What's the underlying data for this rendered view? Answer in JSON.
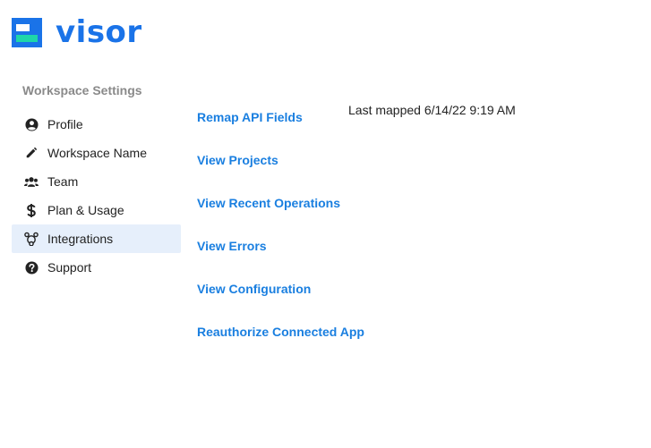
{
  "brand": {
    "name": "visor"
  },
  "sidebar": {
    "heading": "Workspace Settings",
    "items": [
      {
        "label": "Profile",
        "icon": "user-circle-icon"
      },
      {
        "label": "Workspace Name",
        "icon": "pencil-icon"
      },
      {
        "label": "Team",
        "icon": "users-icon"
      },
      {
        "label": "Plan & Usage",
        "icon": "dollar-icon"
      },
      {
        "label": "Integrations",
        "icon": "integrations-icon",
        "active": true
      },
      {
        "label": "Support",
        "icon": "question-circle-icon"
      }
    ]
  },
  "main": {
    "actions": [
      {
        "label": "Remap API Fields"
      },
      {
        "label": "View Projects"
      },
      {
        "label": "View Recent Operations"
      },
      {
        "label": "View Errors"
      },
      {
        "label": "View Configuration"
      },
      {
        "label": "Reauthorize Connected App"
      }
    ],
    "last_mapped": "Last mapped 6/14/22 9:19 AM"
  },
  "colors": {
    "brand_blue": "#1a73e8",
    "brand_green": "#1ed6a9",
    "link_blue": "#1a7fe0",
    "active_bg": "#e6effb"
  }
}
